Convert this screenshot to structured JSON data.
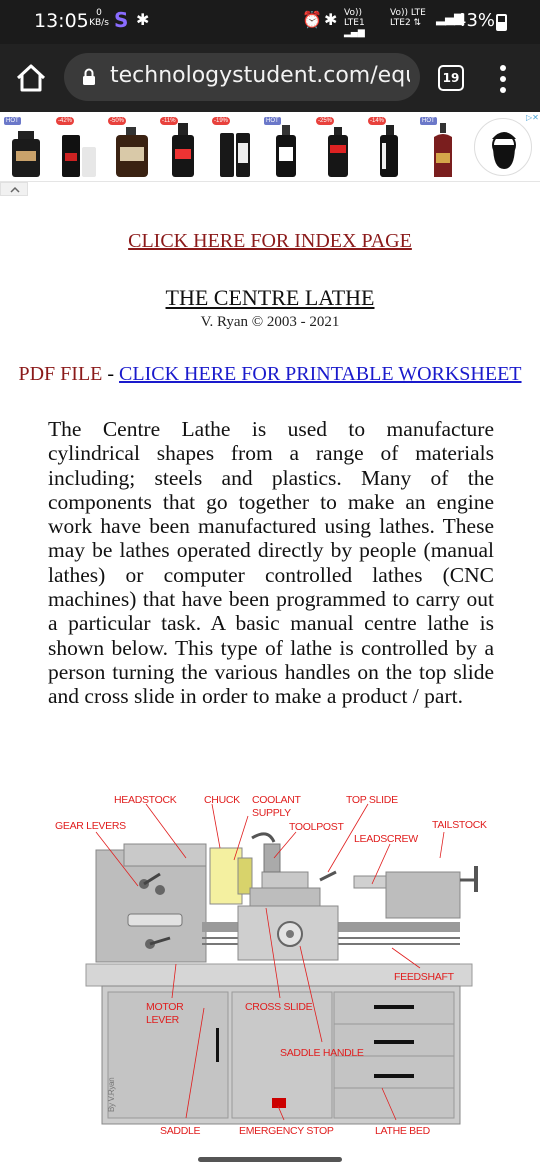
{
  "status_bar": {
    "time": "13:05",
    "speed_value": "0",
    "speed_unit": "KB/s",
    "battery": "43%",
    "sim1_top": "Vo))",
    "sim1_bottom": "LTE1",
    "sim2_top": "Vo)) LTE",
    "sim2_bottom": "LTE2"
  },
  "browser": {
    "url": "technologystudent.com/equi",
    "tab_count": "19"
  },
  "ad": {
    "badges": [
      "HOT",
      "-42%",
      "-50%",
      "-11%",
      "-19%",
      "HOT",
      "-25%",
      "-14%",
      "HOT"
    ]
  },
  "page": {
    "index_link": "CLICK HERE FOR INDEX PAGE",
    "title": "THE CENTRE LATHE",
    "byline": "V. Ryan © 2003 - 2021",
    "pdf_label": "PDF FILE",
    "pdf_separator": " - ",
    "pdf_link": "CLICK HERE FOR PRINTABLE WORKSHEET",
    "body": "The Centre Lathe is used to manufacture cylindrical shapes from a range of materials including; steels and plastics. Many of the components that go together to make an engine work have been manufactured using lathes. These may be lathes operated directly by people (manual lathes) or computer controlled lathes (CNC machines) that have been programmed to carry out a particular task. A basic manual centre lathe is shown below. This type of lathe is controlled by a person turning the various handles on the top slide and cross slide in order to make a product / part."
  },
  "diagram": {
    "labels": {
      "headstock": "HEADSTOCK",
      "chuck": "CHUCK",
      "coolant_1": "COOLANT",
      "coolant_2": "SUPPLY",
      "top_slide": "TOP SLIDE",
      "gear_levers": "GEAR LEVERS",
      "toolpost": "TOOLPOST",
      "tailstock": "TAILSTOCK",
      "leadscrew": "LEADSCREW",
      "feedshaft": "FEEDSHAFT",
      "motor_1": "MOTOR",
      "motor_2": "LEVER",
      "cross_slide": "CROSS SLIDE",
      "saddle_handle": "SADDLE HANDLE",
      "saddle": "SADDLE",
      "emergency_stop": "EMERGENCY STOP",
      "lathe_bed": "LATHE BED",
      "credit": "By V.Ryan"
    }
  }
}
